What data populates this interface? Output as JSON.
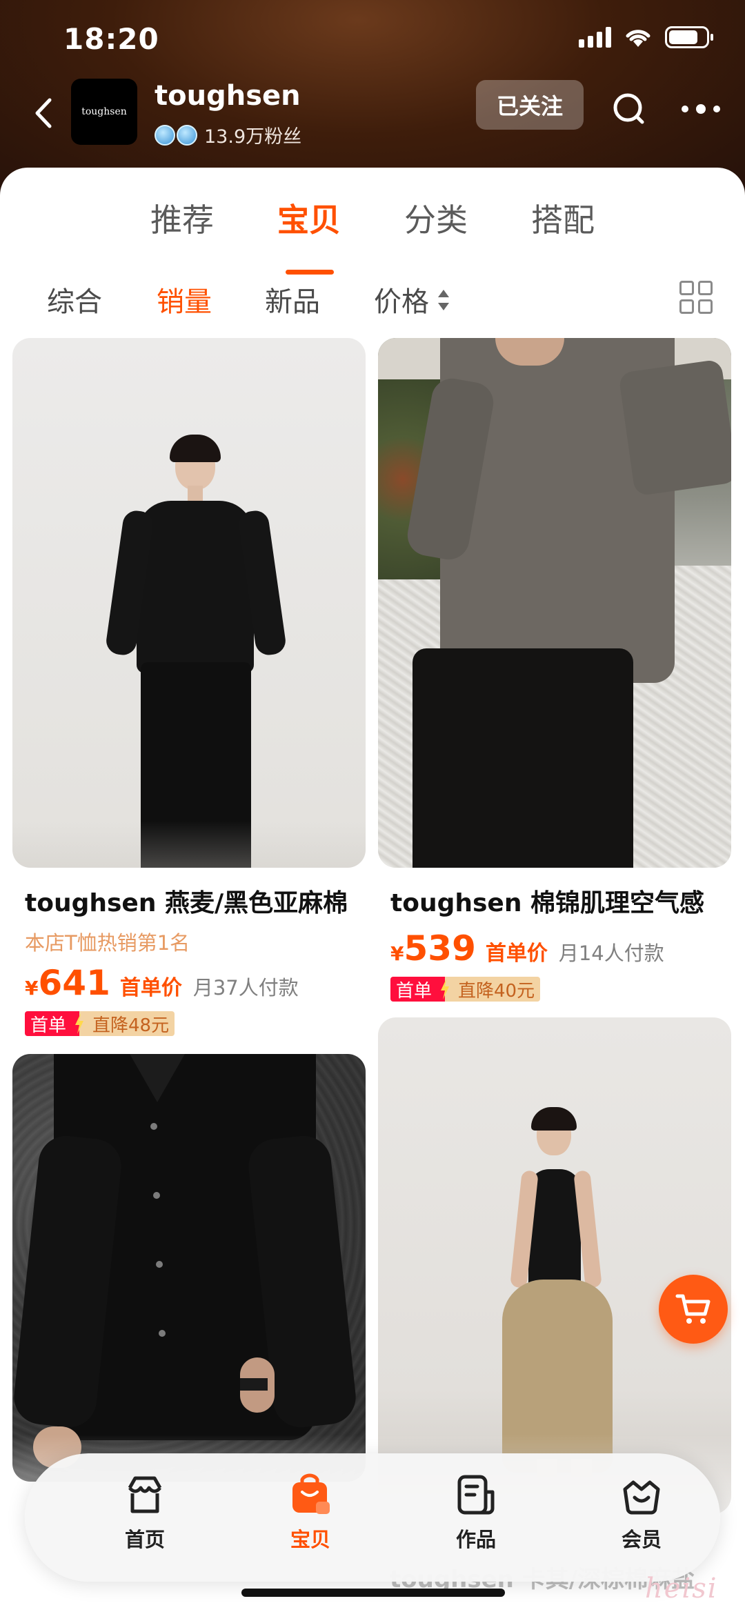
{
  "status_bar": {
    "time": "18:20"
  },
  "shop": {
    "logo_text": "toughsen",
    "name": "toughsen",
    "followers": "13.9万粉丝",
    "follow_label": "已关注"
  },
  "main_tabs": [
    {
      "label": "推荐"
    },
    {
      "label": "宝贝"
    },
    {
      "label": "分类"
    },
    {
      "label": "搭配"
    }
  ],
  "active_main_tab": "宝贝",
  "sort_options": [
    {
      "label": "综合"
    },
    {
      "label": "销量"
    },
    {
      "label": "新品"
    },
    {
      "label": "价格"
    }
  ],
  "active_sort": "销量",
  "products": [
    {
      "title": "toughsen 燕麦/黑色亚麻棉",
      "subtitle": "本店T恤热销第1名",
      "currency": "¥",
      "price": "641",
      "price_label": "首单价",
      "sales": "月37人付款",
      "promo_first": "首单",
      "promo_drop": "直降48元"
    },
    {
      "title": "toughsen 棉锦肌理空气感",
      "currency": "¥",
      "price": "539",
      "price_label": "首单价",
      "sales": "月14人付款",
      "promo_first": "首单",
      "promo_drop": "直降40元"
    },
    {},
    {
      "title": "toughsen 卡其/深棕棉麻盐"
    }
  ],
  "bottom_nav": [
    {
      "label": "首页",
      "icon": "shop-home-icon"
    },
    {
      "label": "宝贝",
      "icon": "shopping-bag-icon"
    },
    {
      "label": "作品",
      "icon": "works-icon"
    },
    {
      "label": "会员",
      "icon": "membership-basket-icon"
    }
  ],
  "active_nav": "宝贝",
  "watermark": "heisi",
  "colors": {
    "accent": "#ff5000",
    "promo_red": "#ff0f3d",
    "promo_gold": "#f3d3a3",
    "header_brown": "#3e1d0b"
  }
}
